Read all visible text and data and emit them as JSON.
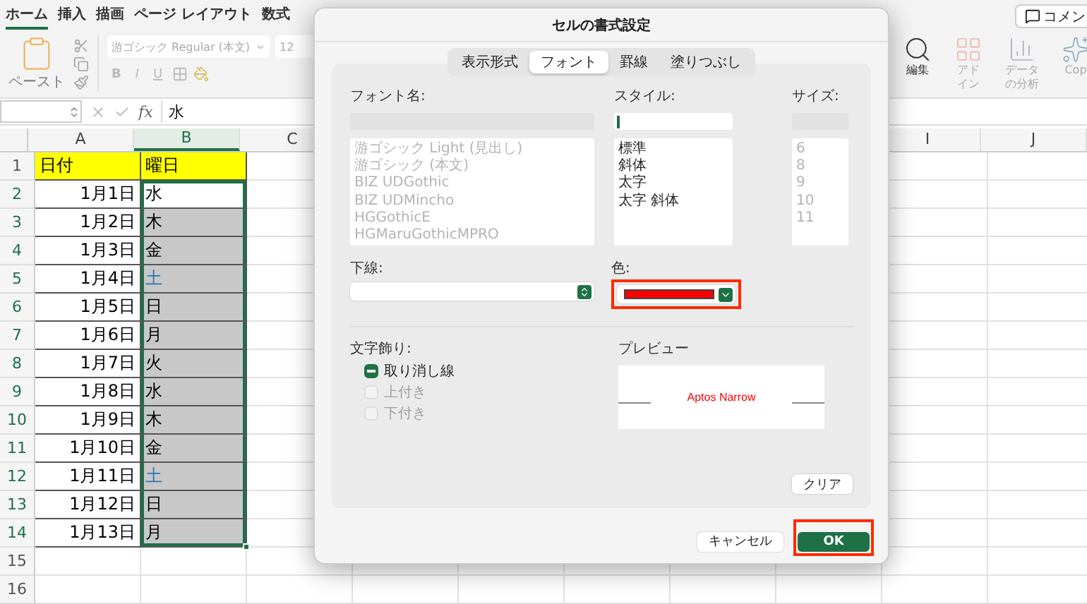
{
  "ribbon": {
    "tabs": [
      {
        "label": "ホーム",
        "selected": true
      },
      {
        "label": "挿入",
        "selected": false
      },
      {
        "label": "描画",
        "selected": false
      },
      {
        "label": "ページ レイアウト",
        "selected": false
      },
      {
        "label": "数式",
        "selected": false
      }
    ],
    "comment_button": "コメン",
    "paste_label": "ペースト",
    "font_name": "游ゴシック Regular (本文)",
    "font_size": "12",
    "format_buttons": [
      "B",
      "I",
      "U"
    ],
    "right_groups": [
      {
        "kind": "search",
        "lines": [
          "編集"
        ]
      },
      {
        "kind": "addin",
        "lines": [
          "アド",
          "イン"
        ]
      },
      {
        "kind": "analysis",
        "lines": [
          "データ",
          "の分析"
        ]
      },
      {
        "kind": "copilot",
        "lines": [
          "Cop"
        ]
      }
    ]
  },
  "formula_bar": {
    "fx": "fx",
    "value": "水"
  },
  "sheet": {
    "columns": [
      {
        "label": "A",
        "selected": false
      },
      {
        "label": "B",
        "selected": true
      },
      {
        "label": "C",
        "selected": false
      },
      {
        "label": "I",
        "selected": false
      },
      {
        "label": "J",
        "selected": false
      }
    ],
    "rows": [
      {
        "number": "1",
        "kind": "header",
        "selected": false,
        "a": "日付",
        "b": {
          "text": "曜日"
        }
      },
      {
        "number": "2",
        "kind": "data",
        "selected": true,
        "a": "1月1日",
        "b": {
          "text": "水",
          "shaded": false,
          "selected": true,
          "color": "#000000"
        }
      },
      {
        "number": "3",
        "kind": "data",
        "selected": true,
        "a": "1月2日",
        "b": {
          "text": "木",
          "shaded": true,
          "selected": true,
          "color": "#000000"
        }
      },
      {
        "number": "4",
        "kind": "data",
        "selected": true,
        "a": "1月3日",
        "b": {
          "text": "金",
          "shaded": true,
          "selected": true,
          "color": "#000000"
        }
      },
      {
        "number": "5",
        "kind": "data",
        "selected": true,
        "a": "1月4日",
        "b": {
          "text": "土",
          "shaded": true,
          "selected": true,
          "color": "#2e75b6"
        }
      },
      {
        "number": "6",
        "kind": "data",
        "selected": true,
        "a": "1月5日",
        "b": {
          "text": "日",
          "shaded": true,
          "selected": true,
          "color": "#000000"
        }
      },
      {
        "number": "7",
        "kind": "data",
        "selected": true,
        "a": "1月6日",
        "b": {
          "text": "月",
          "shaded": true,
          "selected": true,
          "color": "#000000"
        }
      },
      {
        "number": "8",
        "kind": "data",
        "selected": true,
        "a": "1月7日",
        "b": {
          "text": "火",
          "shaded": true,
          "selected": true,
          "color": "#000000"
        }
      },
      {
        "number": "9",
        "kind": "data",
        "selected": true,
        "a": "1月8日",
        "b": {
          "text": "水",
          "shaded": true,
          "selected": true,
          "color": "#000000"
        }
      },
      {
        "number": "10",
        "kind": "data",
        "selected": true,
        "a": "1月9日",
        "b": {
          "text": "木",
          "shaded": true,
          "selected": true,
          "color": "#000000"
        }
      },
      {
        "number": "11",
        "kind": "data",
        "selected": true,
        "a": "1月10日",
        "b": {
          "text": "金",
          "shaded": true,
          "selected": true,
          "color": "#000000"
        }
      },
      {
        "number": "12",
        "kind": "data",
        "selected": true,
        "a": "1月11日",
        "b": {
          "text": "土",
          "shaded": true,
          "selected": true,
          "color": "#2e75b6"
        }
      },
      {
        "number": "13",
        "kind": "data",
        "selected": true,
        "a": "1月12日",
        "b": {
          "text": "日",
          "shaded": true,
          "selected": true,
          "color": "#000000"
        }
      },
      {
        "number": "14",
        "kind": "data",
        "selected": true,
        "a": "1月13日",
        "b": {
          "text": "月",
          "shaded": true,
          "selected": true,
          "color": "#000000"
        }
      },
      {
        "number": "15",
        "kind": "empty",
        "selected": false
      },
      {
        "number": "16",
        "kind": "empty",
        "selected": false
      }
    ]
  },
  "dialog": {
    "title": "セルの書式設定",
    "tabs": [
      {
        "label": "表示形式",
        "selected": false
      },
      {
        "label": "フォント",
        "selected": true
      },
      {
        "label": "罫線",
        "selected": false
      },
      {
        "label": "塗りつぶし",
        "selected": false
      }
    ],
    "font_label": "フォント名:",
    "style_label": "スタイル:",
    "size_label": "サイズ:",
    "font_list": {
      "disabled": true,
      "items": [
        "游ゴシック Light (見出し)",
        "游ゴシック (本文)",
        "BIZ UDGothic",
        "BIZ UDMincho",
        "HGGothicE",
        "HGMaruGothicMPRO"
      ]
    },
    "style_list": {
      "disabled": false,
      "items": [
        "標準",
        "斜体",
        "太字",
        "太字 斜体"
      ]
    },
    "size_list": {
      "disabled": true,
      "items": [
        "6",
        "8",
        "9",
        "10",
        "11"
      ]
    },
    "underline_label": "下線:",
    "color_label": "色:",
    "color": {
      "color": "#ff0000",
      "highlighted": true
    },
    "effects_label": "文字飾り:",
    "effects": [
      {
        "label": "取り消し線",
        "checked": true,
        "mixed": true,
        "disabled": false
      },
      {
        "label": "上付き",
        "checked": false,
        "disabled": true
      },
      {
        "label": "下付き",
        "checked": false,
        "disabled": true
      }
    ],
    "preview_label": "プレビュー",
    "preview_text": "Aptos Narrow",
    "clear_button": "クリア",
    "buttons": [
      {
        "label": "キャンセル",
        "kind": "secondary",
        "highlighted": false
      },
      {
        "label": "OK",
        "kind": "primary",
        "highlighted": true
      }
    ]
  }
}
